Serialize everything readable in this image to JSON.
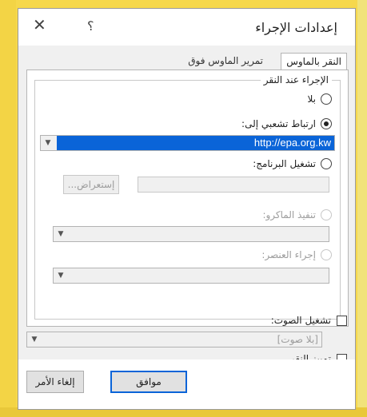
{
  "dialog": {
    "title": "إعدادات الإجراء",
    "close_glyph": "✕",
    "help_glyph": "؟"
  },
  "tabs": [
    {
      "label": "النقر بالماوس"
    },
    {
      "label": "تمرير الماوس فوق"
    }
  ],
  "action_group": {
    "legend": "الإجراء عند النقر",
    "options": {
      "none": {
        "label": "بلا",
        "selected": false
      },
      "hyperlink": {
        "label": "ارتباط تشعبي إلى:",
        "selected": true
      },
      "run_program": {
        "label": "تشغيل البرنامج:",
        "selected": false
      },
      "run_macro": {
        "label": "تنفيذ الماكرو:",
        "enabled": false
      },
      "object_action": {
        "label": "إجراء العنصر:",
        "enabled": false
      }
    },
    "hyperlink_value": "http://epa.org.kw",
    "run_program_value": "",
    "browse_label": "إستعراض..."
  },
  "play_sound": {
    "label": "تشغيل الصوت:",
    "checked": false,
    "value": "[بلا صوت]"
  },
  "highlight_click": {
    "label": "تمييز النقر",
    "checked": false
  },
  "buttons": {
    "ok": "موافق",
    "cancel": "إلغاء الأمر"
  },
  "icons": {
    "dropdown": "chevron-down-icon",
    "close": "close-icon",
    "help": "help-icon"
  }
}
